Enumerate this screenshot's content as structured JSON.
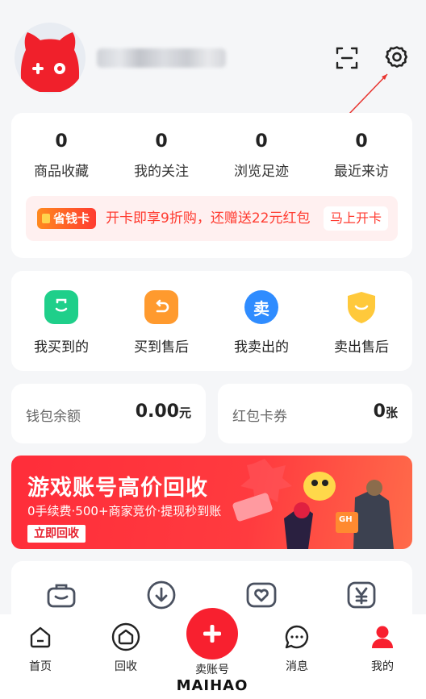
{
  "stats": [
    {
      "value": "0",
      "label": "商品收藏"
    },
    {
      "value": "0",
      "label": "我的关注"
    },
    {
      "value": "0",
      "label": "浏览足迹"
    },
    {
      "value": "0",
      "label": "最近来访"
    }
  ],
  "promo": {
    "badge": "省钱卡",
    "text": "开卡即享9折购，还赠送22元红包",
    "button": "马上开卡"
  },
  "orders": [
    {
      "label": "我买到的",
      "icon": "bag-icon",
      "color": "#1fcf8a"
    },
    {
      "label": "买到售后",
      "icon": "return-icon",
      "color": "#ff9a2e"
    },
    {
      "label": "我卖出的",
      "icon": "sell-icon",
      "color": "#2f8cff",
      "glyph": "卖"
    },
    {
      "label": "卖出售后",
      "icon": "shield-icon",
      "color": "#ffc93b"
    }
  ],
  "wallet": {
    "label": "钱包余额",
    "value": "0.00",
    "unit": "元"
  },
  "coupons": {
    "label": "红包卡券",
    "value": "0",
    "unit": "张"
  },
  "banner": {
    "title": "游戏账号高价回收",
    "subtitle": "0手续费·500+商家竞价·提现秒到账",
    "button": "立即回收",
    "card_text": "GH"
  },
  "tools": [
    {
      "icon": "briefcase-icon"
    },
    {
      "icon": "download-icon"
    },
    {
      "icon": "heart-box-icon"
    },
    {
      "icon": "yen-icon"
    }
  ],
  "tabs": [
    {
      "label": "首页",
      "icon": "home-icon"
    },
    {
      "label": "回收",
      "icon": "recycle-icon"
    },
    {
      "label": "卖账号",
      "icon": "plus-icon"
    },
    {
      "label": "消息",
      "icon": "message-icon"
    },
    {
      "label": "我的",
      "icon": "profile-icon"
    }
  ],
  "brand": "MAIHAO",
  "colors": {
    "accent": "#f8202f",
    "promo_bg": "#fff0f0"
  }
}
